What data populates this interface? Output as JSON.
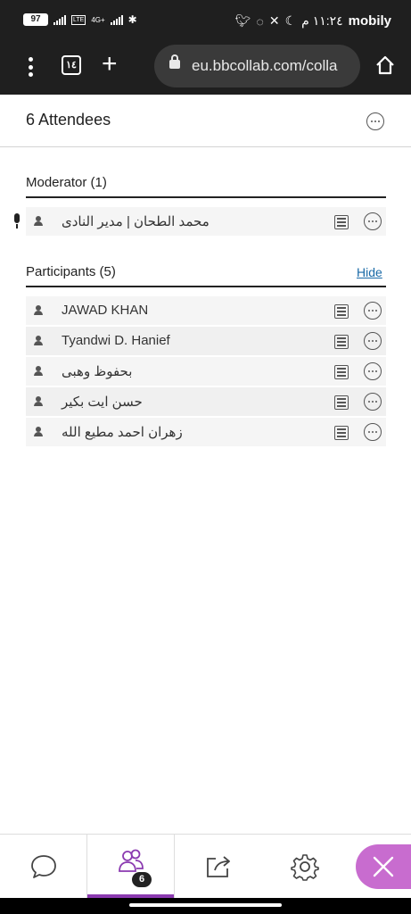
{
  "status_bar": {
    "battery": "97",
    "carrier": "mobily",
    "time": "١١:٢٤ م",
    "network": "4G+"
  },
  "browser": {
    "tab_count": "١٤",
    "url": "eu.bbcollab.com/colla"
  },
  "panel": {
    "title": "6 Attendees"
  },
  "moderators": {
    "title": "Moderator (1)",
    "items": [
      {
        "name": "محمد الطحان | مدير النادى"
      }
    ]
  },
  "participants": {
    "title": "Participants (5)",
    "hide_label": "Hide",
    "items": [
      {
        "name": "JAWAD KHAN"
      },
      {
        "name": "Tyandwi D. Hanief"
      },
      {
        "name": "بحفوظ وهبى"
      },
      {
        "name": "حسن ايت بكير"
      },
      {
        "name": "زهران احمد مطيع الله"
      }
    ]
  },
  "bottom_nav": {
    "attendee_badge": "6",
    "items": [
      "chat-icon",
      "attendees-icon",
      "share-icon",
      "settings-icon",
      "close-icon"
    ]
  },
  "colors": {
    "accent": "#8b3ab0",
    "close_button": "#c86ccf",
    "link": "#1a6aa7"
  }
}
